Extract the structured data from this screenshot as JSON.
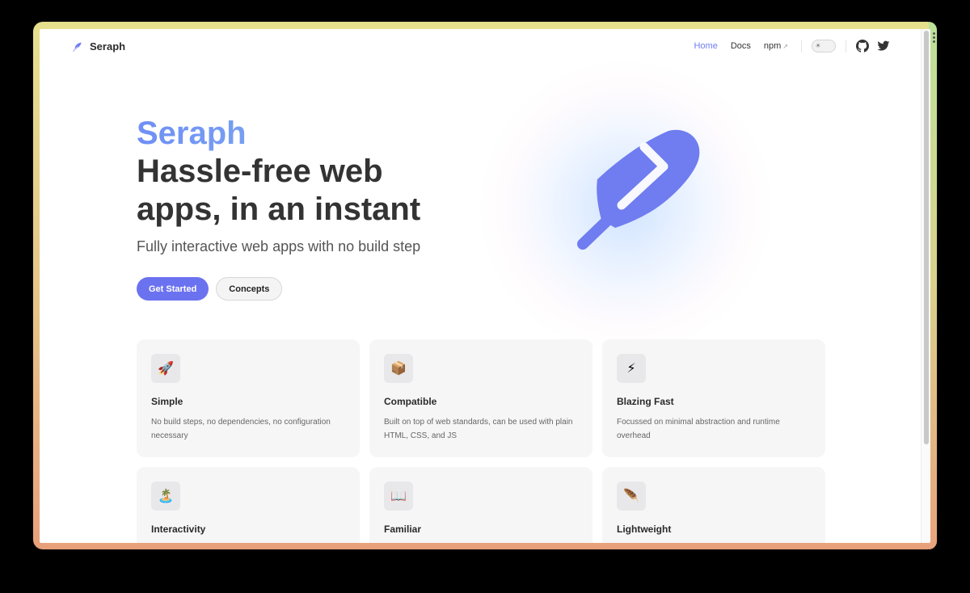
{
  "nav": {
    "brand": "Seraph",
    "links": [
      {
        "label": "Home",
        "active": true
      },
      {
        "label": "Docs",
        "active": false
      },
      {
        "label": "npm",
        "external": true
      }
    ],
    "external_arrow": "↗",
    "theme_toggle_icon": "sun-icon",
    "social": [
      "github-icon",
      "twitter-icon"
    ]
  },
  "hero": {
    "brand": "Seraph",
    "headline": "Hassle-free web apps, in an instant",
    "subtitle": "Fully interactive web apps with no build step",
    "primary_cta": "Get Started",
    "secondary_cta": "Concepts",
    "logo": "feather-logo"
  },
  "features": [
    {
      "icon": "🚀",
      "title": "Simple",
      "desc": "No build steps, no dependencies, no configuration necessary"
    },
    {
      "icon": "📦",
      "title": "Compatible",
      "desc": "Built on top of web standards, can be used with plain HTML, CSS, and JS"
    },
    {
      "icon": "⚡",
      "title": "Blazing Fast",
      "desc": "Focussed on minimal abstraction and runtime overhead"
    },
    {
      "icon": "🏝️",
      "title": "Interactivity",
      "desc": ""
    },
    {
      "icon": "📖",
      "title": "Familiar",
      "desc": ""
    },
    {
      "icon": "🪶",
      "title": "Lightweight",
      "desc": ""
    }
  ],
  "colors": {
    "accent": "#6b72f0",
    "link_active": "#6f7df0",
    "brand_gradient_start": "#6f8ff5",
    "brand_gradient_end": "#86c1ee",
    "logo": "#6f7df0"
  }
}
